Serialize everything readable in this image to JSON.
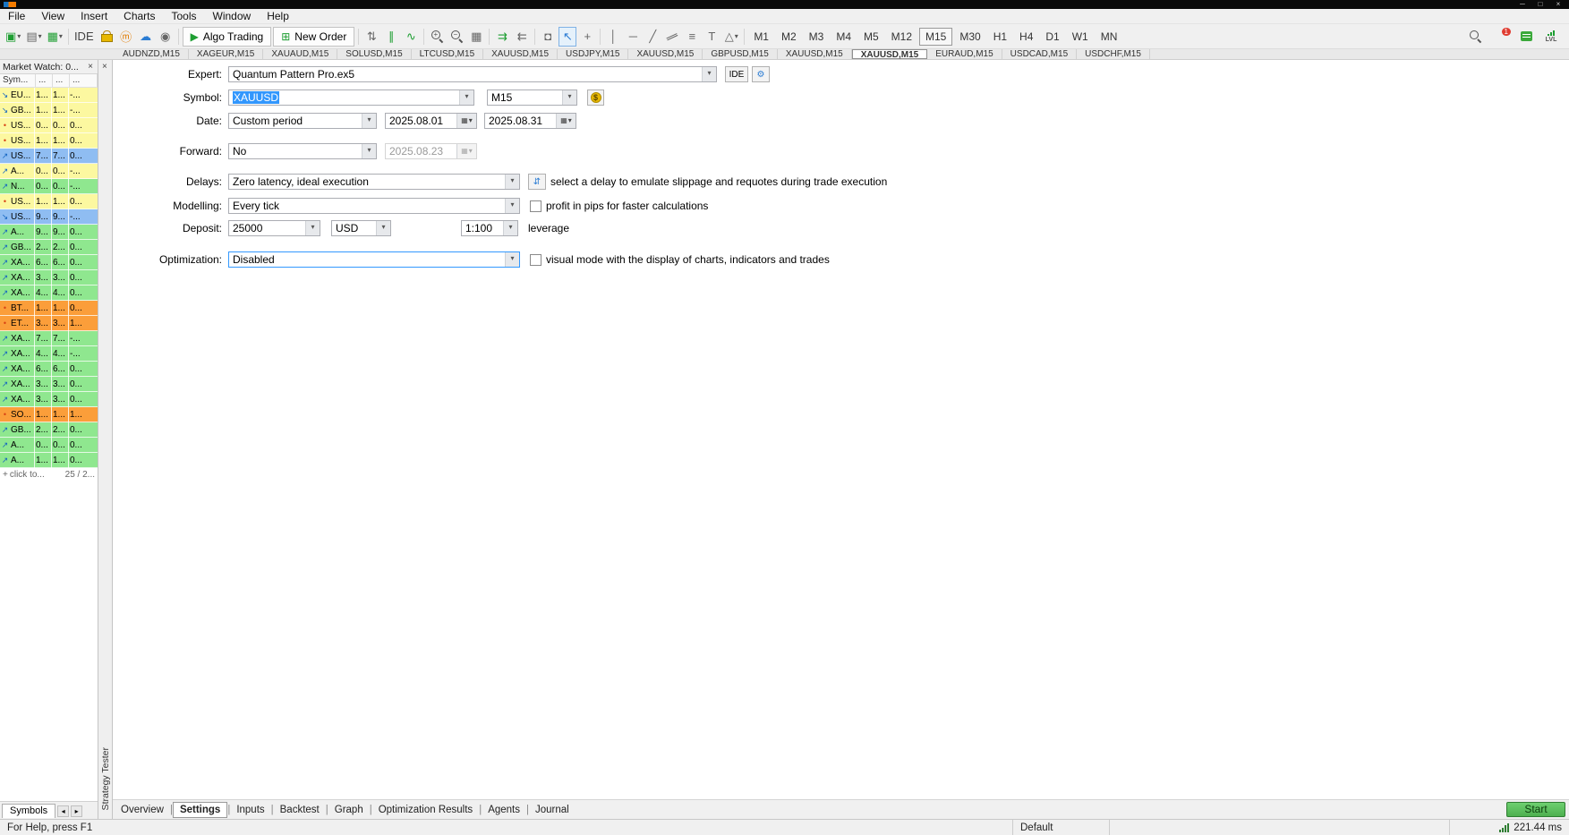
{
  "colors": {
    "row_yellow": "#fcf8a0",
    "row_green": "#8fe78f",
    "row_blue": "#8fbdf2",
    "row_orange": "#fb9e3a",
    "selection_blue": "#3297fd",
    "start_green": "#4db04f",
    "accent_green": "#1e9e32",
    "accent_blue": "#2b7cd3",
    "badge_red": "#e03c31",
    "gold": "#e8b800",
    "latency_green": "#2e7d32",
    "tick_blue": "#1565c0",
    "tick_red": "#d84315"
  },
  "icons": {
    "caret_down": "▾",
    "minimize": "─",
    "maximize": "□",
    "close": "×",
    "new_chart": "▣",
    "profiles": "▤",
    "templates": "▦",
    "metaeditor": "ⓜ",
    "cloud": "☁",
    "vps": "◉",
    "play": "▶",
    "new_order": "⊞",
    "updown_arrows": "⇅",
    "market_depth": "∥",
    "tick_chart": "∿",
    "zoom_in_sign": "+",
    "zoom_out_sign": "−",
    "tile_windows": "▦",
    "auto_scroll": "⇉",
    "chart_shift": "⇇",
    "camera": "◘",
    "cursor": "↖",
    "crosshair": "+",
    "vertical_line": "│",
    "horizontal_line": "─",
    "trend_line": "╱",
    "channel": "∥",
    "fibonacci": "≡",
    "text_tool": "T",
    "shapes": "△",
    "gear": "⚙",
    "calendar": "▦",
    "dollar": "$",
    "delay_sliders": "⇵",
    "plus": "+",
    "arrow_left": "◂",
    "arrow_right": "▸",
    "tick_up": "↗",
    "tick_down": "↘",
    "tick_dot": "•"
  },
  "menu": {
    "items": [
      "File",
      "View",
      "Insert",
      "Charts",
      "Tools",
      "Window",
      "Help"
    ]
  },
  "toolbar": {
    "ide": "IDE",
    "algo_trading": "Algo Trading",
    "new_order": "New Order",
    "timeframes": [
      "M1",
      "M2",
      "M3",
      "M4",
      "M5",
      "M12",
      "M15",
      "M30",
      "H1",
      "H4",
      "D1",
      "W1",
      "MN"
    ],
    "active_timeframe": "M15",
    "notification_count": "1",
    "lvl": "LVL"
  },
  "chart_tabs": {
    "items": [
      "AUDNZD,M15",
      "XAGEUR,M15",
      "XAUAUD,M15",
      "SOLUSD,M15",
      "LTCUSD,M15",
      "XAUUSD,M15",
      "USDJPY,M15",
      "XAUUSD,M15",
      "GBPUSD,M15",
      "XAUUSD,M15",
      "XAUUSD,M15",
      "EURAUD,M15",
      "USDCAD,M15",
      "USDCHF,M15"
    ],
    "active_index": 10
  },
  "market_watch": {
    "title": "Market Watch: 0...",
    "columns": [
      "Sym...",
      "...",
      "...",
      "..."
    ],
    "rows": [
      {
        "symbol": "EU...",
        "bid": "1...",
        "ask": "1...",
        "change": "-...",
        "color": "yellow",
        "dir": "down"
      },
      {
        "symbol": "GB...",
        "bid": "1...",
        "ask": "1...",
        "change": "-...",
        "color": "yellow",
        "dir": "down"
      },
      {
        "symbol": "US...",
        "bid": "0...",
        "ask": "0...",
        "change": "0...",
        "color": "yellow",
        "dir": "dot"
      },
      {
        "symbol": "US...",
        "bid": "1...",
        "ask": "1...",
        "change": "0...",
        "color": "yellow",
        "dir": "dot"
      },
      {
        "symbol": "US...",
        "bid": "7...",
        "ask": "7...",
        "change": "0...",
        "color": "blue",
        "dir": "up"
      },
      {
        "symbol": "A...",
        "bid": "0...",
        "ask": "0...",
        "change": "-...",
        "color": "yellow",
        "dir": "up"
      },
      {
        "symbol": "N...",
        "bid": "0...",
        "ask": "0...",
        "change": "-...",
        "color": "green",
        "dir": "up"
      },
      {
        "symbol": "US...",
        "bid": "1...",
        "ask": "1...",
        "change": "0...",
        "color": "yellow",
        "dir": "dot"
      },
      {
        "symbol": "US...",
        "bid": "9...",
        "ask": "9...",
        "change": "-...",
        "color": "blue",
        "dir": "down"
      },
      {
        "symbol": "A...",
        "bid": "9...",
        "ask": "9...",
        "change": "0...",
        "color": "green",
        "dir": "up"
      },
      {
        "symbol": "GB...",
        "bid": "2...",
        "ask": "2...",
        "change": "0...",
        "color": "green",
        "dir": "up"
      },
      {
        "symbol": "XA...",
        "bid": "6...",
        "ask": "6...",
        "change": "0...",
        "color": "green",
        "dir": "up"
      },
      {
        "symbol": "XA...",
        "bid": "3...",
        "ask": "3...",
        "change": "0...",
        "color": "green",
        "dir": "up"
      },
      {
        "symbol": "XA...",
        "bid": "4...",
        "ask": "4...",
        "change": "0...",
        "color": "green",
        "dir": "up"
      },
      {
        "symbol": "BT...",
        "bid": "1...",
        "ask": "1...",
        "change": "0...",
        "color": "orange",
        "dir": "dot"
      },
      {
        "symbol": "ET...",
        "bid": "3...",
        "ask": "3...",
        "change": "1...",
        "color": "orange",
        "dir": "dot"
      },
      {
        "symbol": "XA...",
        "bid": "7...",
        "ask": "7...",
        "change": "-...",
        "color": "green",
        "dir": "up"
      },
      {
        "symbol": "XA...",
        "bid": "4...",
        "ask": "4...",
        "change": "-...",
        "color": "green",
        "dir": "up"
      },
      {
        "symbol": "XA...",
        "bid": "6...",
        "ask": "6...",
        "change": "0...",
        "color": "green",
        "dir": "up"
      },
      {
        "symbol": "XA...",
        "bid": "3...",
        "ask": "3...",
        "change": "0...",
        "color": "green",
        "dir": "up"
      },
      {
        "symbol": "XA...",
        "bid": "3...",
        "ask": "3...",
        "change": "0...",
        "color": "green",
        "dir": "up"
      },
      {
        "symbol": "SO...",
        "bid": "1...",
        "ask": "1...",
        "change": "1...",
        "color": "orange",
        "dir": "dot"
      },
      {
        "symbol": "GB...",
        "bid": "2...",
        "ask": "2...",
        "change": "0...",
        "color": "green",
        "dir": "up"
      },
      {
        "symbol": "A...",
        "bid": "0...",
        "ask": "0...",
        "change": "0...",
        "color": "green",
        "dir": "up"
      },
      {
        "symbol": "A...",
        "bid": "1...",
        "ask": "1...",
        "change": "0...",
        "color": "green",
        "dir": "up"
      }
    ],
    "add_label": "click to...",
    "counter": "25 / 2...",
    "bottom_tabs": [
      "Symbols"
    ]
  },
  "tester": {
    "panel_label": "Strategy Tester",
    "expert": {
      "label": "Expert:",
      "value": "Quantum Pattern Pro.ex5",
      "ide_button": "IDE"
    },
    "symbol": {
      "label": "Symbol:",
      "value": "XAUUSD",
      "period": "M15"
    },
    "date": {
      "label": "Date:",
      "range": "Custom period",
      "from": "2025.08.01",
      "to": "2025.08.31"
    },
    "forward": {
      "label": "Forward:",
      "value": "No",
      "date": "2025.08.23"
    },
    "delays": {
      "label": "Delays:",
      "value": "Zero latency, ideal execution",
      "hint": "select a delay to emulate slippage and requotes during trade execution"
    },
    "modelling": {
      "label": "Modelling:",
      "value": "Every tick",
      "checkbox": "profit in pips for faster calculations"
    },
    "deposit": {
      "label": "Deposit:",
      "amount": "25000",
      "currency": "USD",
      "leverage": "1:100",
      "leverage_label": "leverage"
    },
    "optimization": {
      "label": "Optimization:",
      "value": "Disabled",
      "checkbox": "visual mode with the display of charts, indicators and trades"
    },
    "tabs": [
      "Overview",
      "Settings",
      "Inputs",
      "Backtest",
      "Graph",
      "Optimization Results",
      "Agents",
      "Journal"
    ],
    "active_tab": "Settings",
    "tab_separator": "|",
    "start_button": "Start"
  },
  "statusbar": {
    "help": "For Help, press F1",
    "profile": "Default",
    "latency": "221.44 ms"
  }
}
